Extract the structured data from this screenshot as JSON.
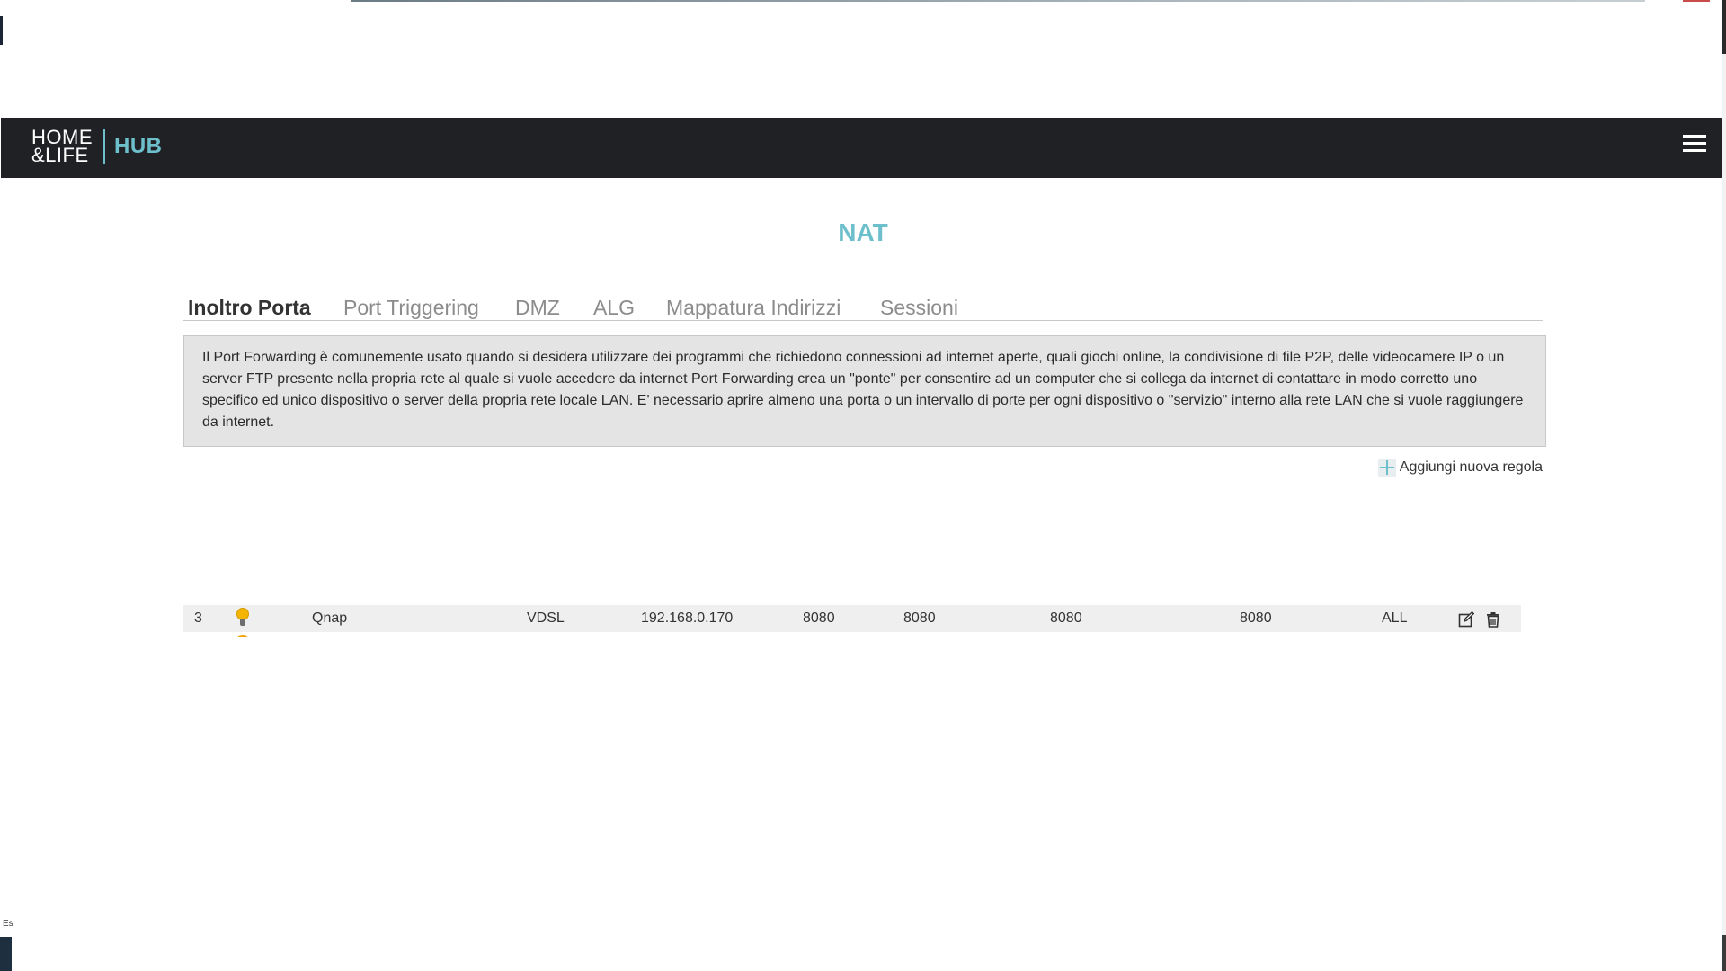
{
  "header": {
    "logo_line1": "HOME",
    "logo_line2": "&LIFE",
    "logo_hub": "HUB",
    "menu_icon": "hamburger-menu-icon"
  },
  "page": {
    "title": "NAT"
  },
  "tabs": [
    {
      "label": "Inoltro Porta",
      "active": true
    },
    {
      "label": "Port Triggering",
      "active": false
    },
    {
      "label": "DMZ",
      "active": false
    },
    {
      "label": "ALG",
      "active": false
    },
    {
      "label": "Mappatura Indirizzi",
      "active": false
    },
    {
      "label": "Sessioni",
      "active": false
    }
  ],
  "info": {
    "text": "Il Port Forwarding è comunemente usato quando si desidera utilizzare dei programmi che richiedono connessioni ad internet aperte, quali giochi online, la condivisione di file P2P, delle videocamere IP o un server FTP presente nella propria rete al quale si vuole accedere da internet Port Forwarding crea un \"ponte\" per consentire ad un computer che si collega da internet di contattare in modo corretto uno specifico ed unico dispositivo o server della propria rete locale LAN. E' necessario aprire almeno una porta o un intervallo di porte per ogni dispositivo o \"servizio\" interno alla rete LAN che si vuole raggiungere da internet."
  },
  "actions": {
    "add_rule_label": "Aggiungi nuova regola",
    "add_rule_icon": "plus-icon"
  },
  "rules": [
    {
      "index": "3",
      "status_icon": "lightbulb-icon",
      "name": "Qnap",
      "interface": "VDSL",
      "ip": "192.168.0.170",
      "port1": "8080",
      "port2": "8080",
      "port3": "8080",
      "port4": "8080",
      "protocol": "ALL",
      "edit_icon": "edit-icon",
      "delete_icon": "trash-icon"
    }
  ],
  "colors": {
    "accent": "#6dbfcc",
    "header_bg": "#202124",
    "info_bg": "#e4e4e4",
    "row_bg": "#efefef",
    "bulb": "#f4b400"
  },
  "corner_fragment_text": "Es"
}
